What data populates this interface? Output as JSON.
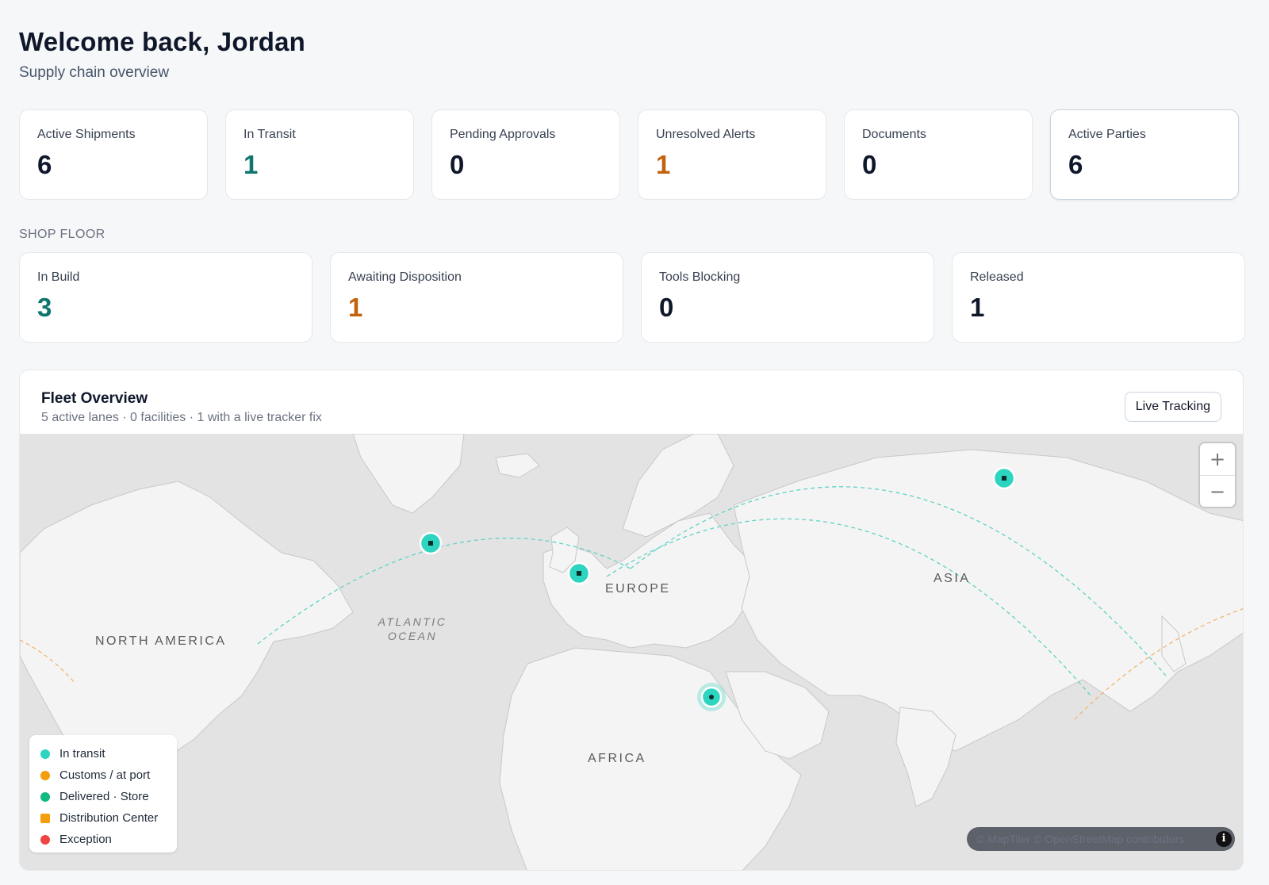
{
  "header": {
    "title": "Welcome back, Jordan",
    "subtitle": "Supply chain overview"
  },
  "stats": [
    {
      "label": "Active Shipments",
      "value": "6"
    },
    {
      "label": "In Transit",
      "value": "1"
    },
    {
      "label": "Pending Approvals",
      "value": "0"
    },
    {
      "label": "Unresolved Alerts",
      "value": "1"
    },
    {
      "label": "Documents",
      "value": "0"
    },
    {
      "label": "Active Parties",
      "value": "6"
    }
  ],
  "shop_floor": {
    "label": "SHOP FLOOR",
    "cards": [
      {
        "label": "In Build",
        "value": "3"
      },
      {
        "label": "Awaiting Disposition",
        "value": "1"
      },
      {
        "label": "Tools Blocking",
        "value": "0"
      },
      {
        "label": "Released",
        "value": "1"
      }
    ]
  },
  "fleet": {
    "title": "Fleet Overview",
    "subtitle": "5 active lanes · 0 facilities · 1 with a live tracker fix",
    "live_tracking_label": "Live Tracking",
    "map_labels": {
      "north_america": "NORTH AMERICA",
      "europe": "EUROPE",
      "asia": "ASIA",
      "africa": "AFRICA",
      "atlantic": "ATLANTIC OCEAN"
    },
    "zoom_in": "+",
    "zoom_out": "−",
    "legend": [
      {
        "label": "In transit",
        "color": "#2dd4bf",
        "shape": "circle"
      },
      {
        "label": "Customs / at port",
        "color": "#f59e0b",
        "shape": "circle"
      },
      {
        "label": "Delivered · Store",
        "color": "#10b981",
        "shape": "circle"
      },
      {
        "label": "Distribution Center",
        "color": "#f59e0b",
        "shape": "square"
      },
      {
        "label": "Exception",
        "color": "#ef4444",
        "shape": "circle"
      }
    ],
    "attribution": "© MapTiler © OpenStreetMap contributors",
    "info_glyph": "i"
  },
  "colors": {
    "teal": "#0f766e",
    "orange": "#c2620c",
    "marker": "#2dd4bf",
    "route": "#5fd3c4",
    "customs_route": "#f2b56b"
  }
}
